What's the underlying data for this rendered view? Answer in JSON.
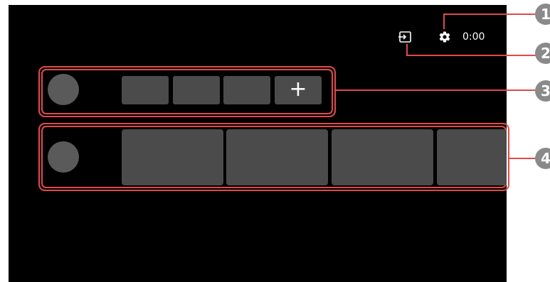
{
  "status_bar": {
    "input_icon": "input-source-icon",
    "settings_icon": "gear-icon",
    "time": "0:00"
  },
  "rows": [
    {
      "name": "apps-row",
      "avatar_color": "#5a5a5a",
      "tiles": [
        "",
        "",
        ""
      ],
      "add_label": "+"
    },
    {
      "name": "content-row",
      "avatar_color": "#5a5a5a",
      "tiles": [
        "",
        "",
        "",
        ""
      ]
    }
  ],
  "callouts": [
    {
      "label": "1"
    },
    {
      "label": "2"
    },
    {
      "label": "3"
    },
    {
      "label": "4"
    }
  ],
  "colors": {
    "background": "#000000",
    "tile": "#4b4b4b",
    "avatar": "#5a5a5a",
    "highlight": "#e04a4a",
    "badge": "#8a8a8a"
  }
}
